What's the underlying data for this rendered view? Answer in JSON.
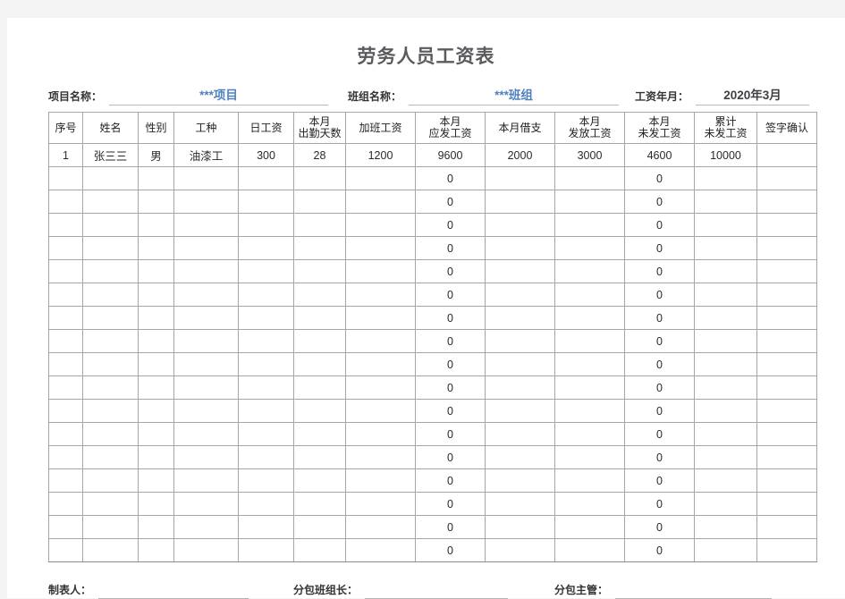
{
  "document": {
    "title": "劳务人员工资表"
  },
  "meta": {
    "project_label": "项目名称：",
    "project_value": "***项目",
    "team_label": "班组名称：",
    "team_value": "***班组",
    "month_label": "工资年月：",
    "month_value": "2020年3月",
    "accent_blue": "#4f81bd",
    "title_color": "#5a5a5f"
  },
  "table": {
    "columns": [
      {
        "line1": "序号",
        "line2": ""
      },
      {
        "line1": "姓名",
        "line2": ""
      },
      {
        "line1": "性别",
        "line2": ""
      },
      {
        "line1": "工种",
        "line2": ""
      },
      {
        "line1": "日工资",
        "line2": ""
      },
      {
        "line1": "本月",
        "line2": "出勤天数"
      },
      {
        "line1": "加班工资",
        "line2": ""
      },
      {
        "line1": "本月",
        "line2": "应发工资"
      },
      {
        "line1": "本月借支",
        "line2": ""
      },
      {
        "line1": "本月",
        "line2": "发放工资"
      },
      {
        "line1": "本月",
        "line2": "未发工资"
      },
      {
        "line1": "累计",
        "line2": "未发工资"
      },
      {
        "line1": "签字确认",
        "line2": ""
      }
    ],
    "rows": [
      [
        "1",
        "张三三",
        "男",
        "油漆工",
        "300",
        "28",
        "1200",
        "9600",
        "2000",
        "3000",
        "4600",
        "10000",
        ""
      ],
      [
        "",
        "",
        "",
        "",
        "",
        "",
        "",
        "0",
        "",
        "",
        "0",
        "",
        ""
      ],
      [
        "",
        "",
        "",
        "",
        "",
        "",
        "",
        "0",
        "",
        "",
        "0",
        "",
        ""
      ],
      [
        "",
        "",
        "",
        "",
        "",
        "",
        "",
        "0",
        "",
        "",
        "0",
        "",
        ""
      ],
      [
        "",
        "",
        "",
        "",
        "",
        "",
        "",
        "0",
        "",
        "",
        "0",
        "",
        ""
      ],
      [
        "",
        "",
        "",
        "",
        "",
        "",
        "",
        "0",
        "",
        "",
        "0",
        "",
        ""
      ],
      [
        "",
        "",
        "",
        "",
        "",
        "",
        "",
        "0",
        "",
        "",
        "0",
        "",
        ""
      ],
      [
        "",
        "",
        "",
        "",
        "",
        "",
        "",
        "0",
        "",
        "",
        "0",
        "",
        ""
      ],
      [
        "",
        "",
        "",
        "",
        "",
        "",
        "",
        "0",
        "",
        "",
        "0",
        "",
        ""
      ],
      [
        "",
        "",
        "",
        "",
        "",
        "",
        "",
        "0",
        "",
        "",
        "0",
        "",
        ""
      ],
      [
        "",
        "",
        "",
        "",
        "",
        "",
        "",
        "0",
        "",
        "",
        "0",
        "",
        ""
      ],
      [
        "",
        "",
        "",
        "",
        "",
        "",
        "",
        "0",
        "",
        "",
        "0",
        "",
        ""
      ],
      [
        "",
        "",
        "",
        "",
        "",
        "",
        "",
        "0",
        "",
        "",
        "0",
        "",
        ""
      ],
      [
        "",
        "",
        "",
        "",
        "",
        "",
        "",
        "0",
        "",
        "",
        "0",
        "",
        ""
      ],
      [
        "",
        "",
        "",
        "",
        "",
        "",
        "",
        "0",
        "",
        "",
        "0",
        "",
        ""
      ],
      [
        "",
        "",
        "",
        "",
        "",
        "",
        "",
        "0",
        "",
        "",
        "0",
        "",
        ""
      ],
      [
        "",
        "",
        "",
        "",
        "",
        "",
        "",
        "0",
        "",
        "",
        "0",
        "",
        ""
      ],
      [
        "",
        "",
        "",
        "",
        "",
        "",
        "",
        "0",
        "",
        "",
        "0",
        "",
        ""
      ]
    ]
  },
  "footer": {
    "preparer_label": "制表人：",
    "preparer_value": "",
    "foreman_label": "分包班组长：",
    "foreman_value": "",
    "supervisor_label": "分包主管：",
    "supervisor_value": ""
  }
}
